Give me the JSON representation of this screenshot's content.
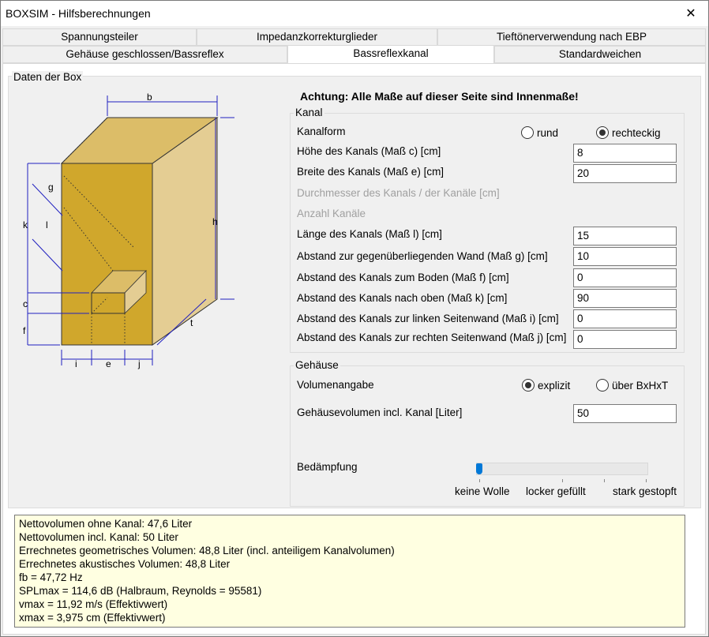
{
  "window": {
    "title": "BOXSIM - Hilfsberechnungen",
    "close_glyph": "✕"
  },
  "tabs_row1": [
    "Spannungsteiler",
    "Impedanzkorrekturglieder",
    "Tieftönerverwendung nach EBP"
  ],
  "tabs_row2": [
    "Gehäuse geschlossen/Bassreflex",
    "Bassreflexkanal",
    "Standardweichen"
  ],
  "active_tab": "Bassreflexkanal",
  "box_group": {
    "label": "Daten der Box"
  },
  "diagram": {
    "labels": {
      "b": "b",
      "h": "h",
      "t": "t",
      "g": "g",
      "k": "k",
      "l": "l",
      "c": "c",
      "f": "f",
      "i": "i",
      "e": "e",
      "j": "j"
    },
    "colors": {
      "front": "#d0a72c",
      "side": "#e4cd93",
      "top": "#dcbd68",
      "dim": "#2020c0"
    }
  },
  "warning": "Achtung: Alle Maße auf dieser Seite sind Innenmaße!",
  "kanal": {
    "group_label": "Kanal",
    "form_label": "Kanalform",
    "radio_round": "rund",
    "radio_rect": "rechteckig",
    "selected": "rechteckig",
    "hoehe_label": "Höhe des Kanals (Maß c) [cm]",
    "hoehe_value": "8",
    "breite_label": "Breite des Kanals (Maß e) [cm]",
    "breite_value": "20",
    "durchmesser_label": "Durchmesser des Kanals / der Kanäle [cm]",
    "anzahl_label": "Anzahl Kanäle",
    "laenge_label": "Länge des Kanals (Maß l) [cm]",
    "laenge_value": "15",
    "abstand_g_label": "Abstand zur gegenüberliegenden Wand (Maß g) [cm]",
    "abstand_g_value": "10",
    "abstand_f_label": "Abstand des Kanals zum Boden (Maß f) [cm]",
    "abstand_f_value": "0",
    "abstand_k_label": "Abstand des Kanals nach oben (Maß k) [cm]",
    "abstand_k_value": "90",
    "abstand_i_label": "Abstand des Kanals zur linken Seitenwand (Maß i) [cm]",
    "abstand_i_value": "0",
    "abstand_j_label": "Abstand des Kanals zur rechten Seitenwand (Maß j) [cm]",
    "abstand_j_value": "0"
  },
  "gehaeuse": {
    "group_label": "Gehäuse",
    "volumen_label": "Volumenangabe",
    "radio_explizit": "explizit",
    "radio_bxhxt": "über BxHxT",
    "selected": "explizit",
    "gv_label": "Gehäusevolumen incl. Kanal [Liter]",
    "gv_value": "50",
    "daempfung_label": "Bedämpfung",
    "daempfung_level": 0,
    "scale_low": "keine Wolle",
    "scale_mid": "locker gefüllt",
    "scale_high": "stark gestopft"
  },
  "results": [
    "Nettovolumen ohne Kanal: 47,6 Liter",
    "Nettovolumen incl. Kanal: 50 Liter",
    "Errechnetes geometrisches Volumen: 48,8 Liter (incl. anteiligem Kanalvolumen)",
    "Errechnetes akustisches Volumen: 48,8 Liter",
    "fb = 47,72 Hz",
    "SPLmax = 114,6 dB (Halbraum, Reynolds = 95581)",
    "vmax = 11,92 m/s (Effektivwert)",
    "xmax = 3,975 cm (Effektivwert)"
  ]
}
